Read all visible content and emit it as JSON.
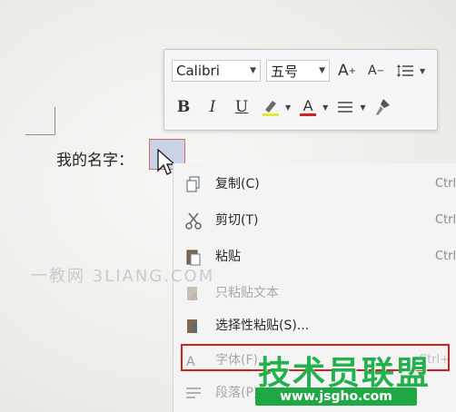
{
  "document": {
    "text": "我的名字："
  },
  "mini_toolbar": {
    "font_name": "Calibri",
    "font_size": "五号",
    "grow_font": "A",
    "shrink_font": "A",
    "bold": "B",
    "italic": "I",
    "underline": "U",
    "font_color": "A"
  },
  "context_menu": {
    "items": [
      {
        "label": "复制(C)",
        "shortcut": "Ctrl",
        "icon": "copy-icon"
      },
      {
        "label": "剪切(T)",
        "shortcut": "Ctrl",
        "icon": "scissors-icon"
      },
      {
        "label": "粘贴",
        "shortcut": "Ctrl",
        "icon": "paste-icon"
      },
      {
        "label": "只粘贴文本",
        "shortcut": "",
        "icon": "paste-text-icon"
      },
      {
        "label": "选择性粘贴(S)...",
        "shortcut": "",
        "icon": "paste-special-icon"
      },
      {
        "label": "字体(F)...",
        "shortcut": "Ctrl+",
        "icon": "font-icon"
      },
      {
        "label": "段落(P)...",
        "shortcut": "",
        "icon": "paragraph-icon"
      }
    ]
  },
  "watermarks": {
    "grey": "一教网 3LIANG.COM",
    "logo": "技术员联盟",
    "url": "www.jsgho.com"
  },
  "colors": {
    "highlight": "#d32020",
    "logo_green": "#22b14c",
    "selection": "#c9d2e6"
  }
}
